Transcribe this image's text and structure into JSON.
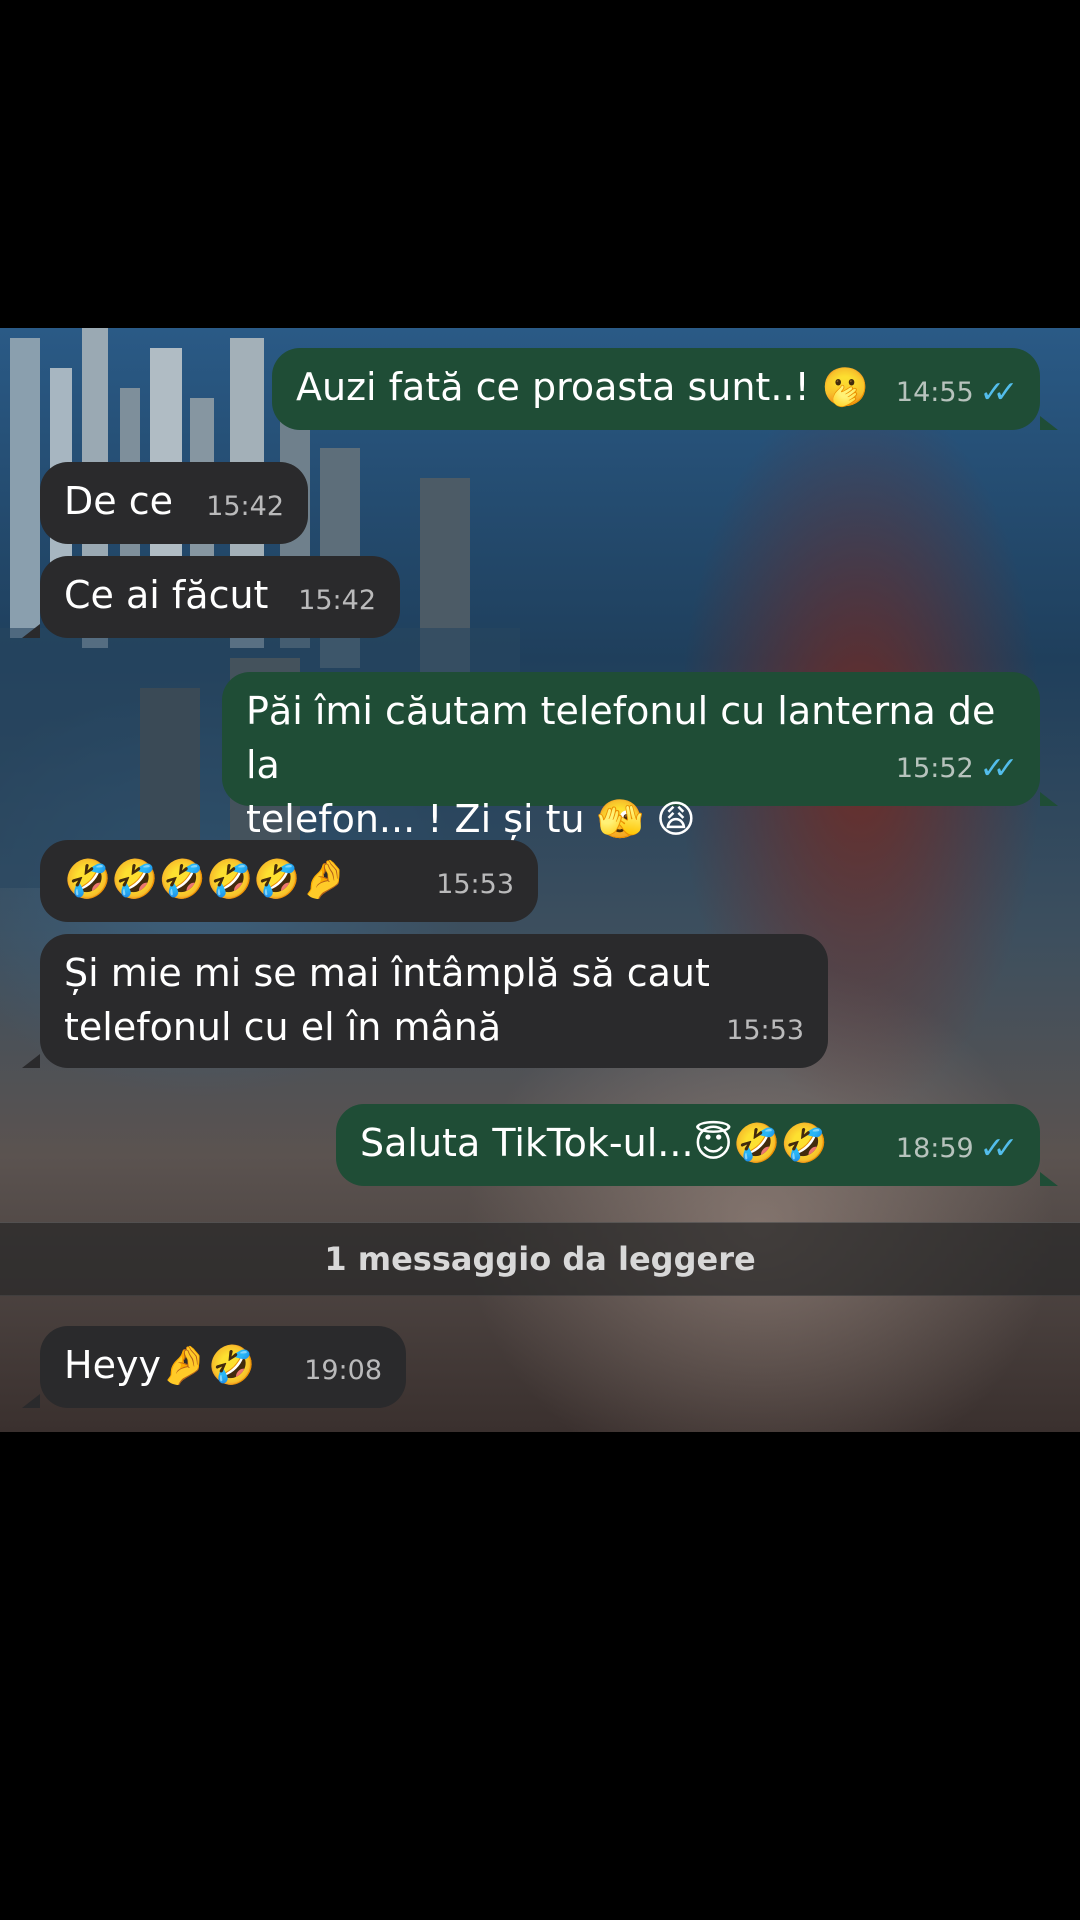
{
  "messages": [
    {
      "direction": "outgoing",
      "text": "Auzi fată ce proasta sunt..! 🫢",
      "time": "14:55",
      "status": "read"
    },
    {
      "direction": "incoming",
      "text": "De ce",
      "time": "15:42"
    },
    {
      "direction": "incoming",
      "text": "Ce ai făcut",
      "time": "15:42"
    },
    {
      "direction": "outgoing",
      "text": "Păi îmi căutam telefonul cu lanterna de la\ntelefon... ! Zi și tu 🫣 😩",
      "time": "15:52",
      "status": "read"
    },
    {
      "direction": "incoming",
      "text": "🤣🤣🤣🤣🤣🤌",
      "time": "15:53"
    },
    {
      "direction": "incoming",
      "text": "Și mie mi se mai întâmplă să caut\ntelefonul cu el în mână",
      "time": "15:53"
    },
    {
      "direction": "outgoing",
      "text": "Saluta TikTok-ul...😇🤣🤣",
      "time": "18:59",
      "status": "read"
    },
    {
      "direction": "incoming",
      "text": "Heyy🤌🤣",
      "time": "19:08"
    }
  ],
  "unread_banner": "1 messaggio da leggere",
  "colors": {
    "outgoing_bubble": "#1f4d36",
    "incoming_bubble": "#2a2a2c",
    "read_ticks": "#53bdeb"
  },
  "icons": {
    "read_receipt": "double-check-icon"
  }
}
